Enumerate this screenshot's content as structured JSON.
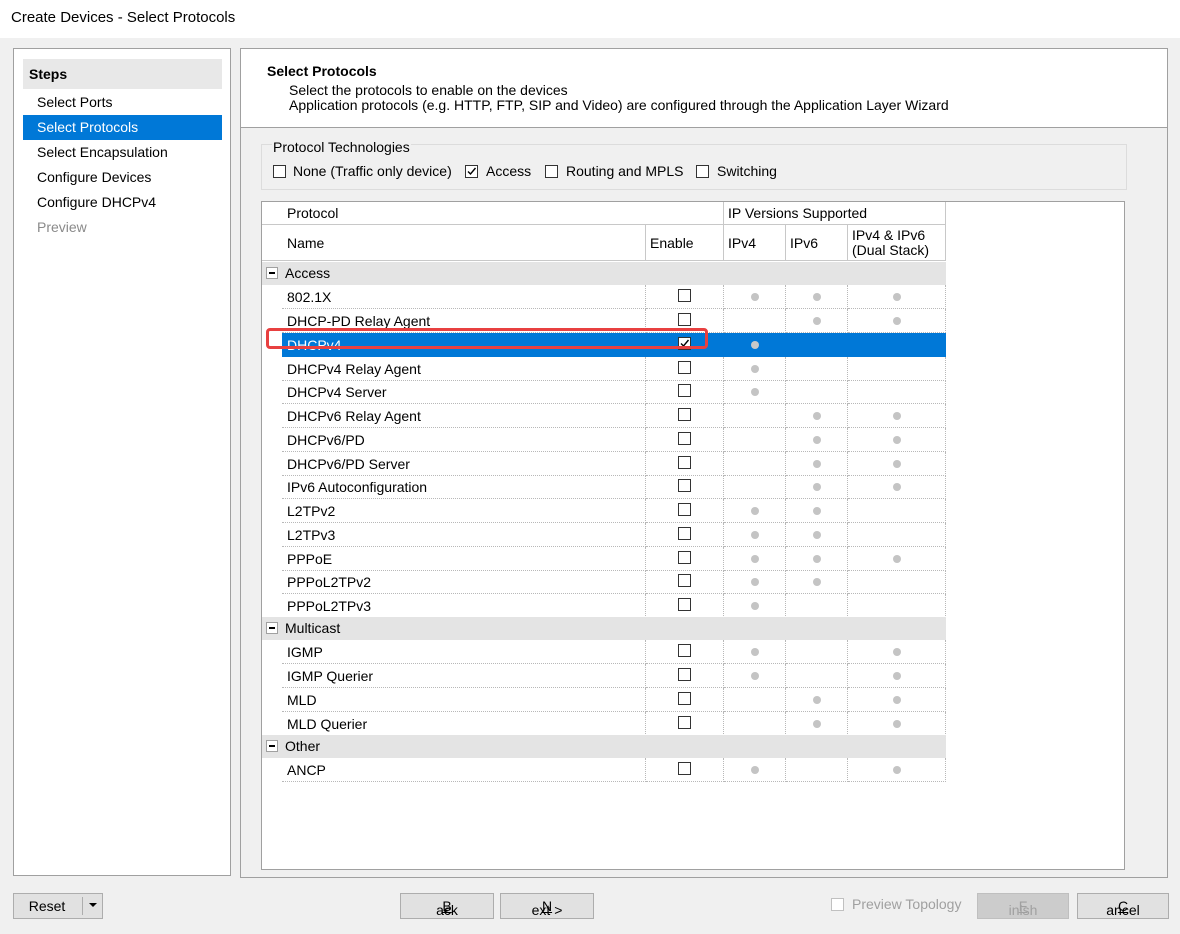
{
  "window": {
    "title": "Create Devices - Select Protocols"
  },
  "steps": {
    "header": "Steps",
    "items": [
      {
        "label": "Select Ports"
      },
      {
        "label": "Select Protocols"
      },
      {
        "label": "Select Encapsulation"
      },
      {
        "label": "Configure Devices"
      },
      {
        "label": "Configure DHCPv4"
      },
      {
        "label": "Preview"
      }
    ]
  },
  "header": {
    "title": "Select Protocols",
    "desc1": "Select the protocols to enable on the devices",
    "desc2": "Application protocols (e.g. HTTP, FTP, SIP and Video) are configured through the Application Layer Wizard"
  },
  "technologies": {
    "legend": "Protocol Technologies",
    "items": [
      {
        "label": "None (Traffic only device)",
        "checked": false
      },
      {
        "label": "Access",
        "checked": true
      },
      {
        "label": "Routing and MPLS",
        "checked": false
      },
      {
        "label": "Switching",
        "checked": false
      }
    ]
  },
  "grid": {
    "headers": {
      "protocol": "Protocol",
      "ip_versions": "IP Versions Supported",
      "name": "Name",
      "enable": "Enable",
      "ipv4": "IPv4",
      "ipv6": "IPv6",
      "dual_line1": "IPv4 & IPv6",
      "dual_line2": "(Dual Stack)"
    },
    "categories": [
      {
        "label": "Access"
      },
      {
        "label": "Multicast"
      },
      {
        "label": "Other"
      }
    ],
    "rows": [
      {
        "name": "802.1X",
        "enabled": false,
        "ipv4": true,
        "ipv6": true,
        "dual": true
      },
      {
        "name": "DHCP-PD Relay Agent",
        "enabled": false,
        "ipv4": false,
        "ipv6": true,
        "dual": true
      },
      {
        "name": "DHCPv4",
        "enabled": true,
        "ipv4": true,
        "ipv6": false,
        "dual": false,
        "selected": true
      },
      {
        "name": "DHCPv4 Relay Agent",
        "enabled": false,
        "ipv4": true,
        "ipv6": false,
        "dual": false
      },
      {
        "name": "DHCPv4 Server",
        "enabled": false,
        "ipv4": true,
        "ipv6": false,
        "dual": false
      },
      {
        "name": "DHCPv6 Relay Agent",
        "enabled": false,
        "ipv4": false,
        "ipv6": true,
        "dual": true
      },
      {
        "name": "DHCPv6/PD",
        "enabled": false,
        "ipv4": false,
        "ipv6": true,
        "dual": true
      },
      {
        "name": "DHCPv6/PD Server",
        "enabled": false,
        "ipv4": false,
        "ipv6": true,
        "dual": true
      },
      {
        "name": "IPv6 Autoconfiguration",
        "enabled": false,
        "ipv4": false,
        "ipv6": true,
        "dual": true
      },
      {
        "name": "L2TPv2",
        "enabled": false,
        "ipv4": true,
        "ipv6": true,
        "dual": false
      },
      {
        "name": "L2TPv3",
        "enabled": false,
        "ipv4": true,
        "ipv6": true,
        "dual": false
      },
      {
        "name": "PPPoE",
        "enabled": false,
        "ipv4": true,
        "ipv6": true,
        "dual": true
      },
      {
        "name": "PPPoL2TPv2",
        "enabled": false,
        "ipv4": true,
        "ipv6": true,
        "dual": false
      },
      {
        "name": "PPPoL2TPv3",
        "enabled": false,
        "ipv4": true,
        "ipv6": false,
        "dual": false
      },
      {
        "name": "IGMP",
        "enabled": false,
        "ipv4": true,
        "ipv6": false,
        "dual": true
      },
      {
        "name": "IGMP Querier",
        "enabled": false,
        "ipv4": true,
        "ipv6": false,
        "dual": true
      },
      {
        "name": "MLD",
        "enabled": false,
        "ipv4": false,
        "ipv6": true,
        "dual": true
      },
      {
        "name": "MLD Querier",
        "enabled": false,
        "ipv4": false,
        "ipv6": true,
        "dual": true
      },
      {
        "name": "ANCP",
        "enabled": false,
        "ipv4": true,
        "ipv6": false,
        "dual": true
      }
    ]
  },
  "buttons": {
    "reset": "Reset",
    "back_pre": "< ",
    "back_key": "B",
    "back_post": "ack",
    "next_key": "N",
    "next_post": "ext >",
    "preview_topology": "Preview Topology",
    "finish_key": "F",
    "finish_post": "inish",
    "cancel_key": "C",
    "cancel_post": "ancel"
  },
  "colors": {
    "selection": "#0078d7",
    "highlight_box": "#e84040"
  }
}
